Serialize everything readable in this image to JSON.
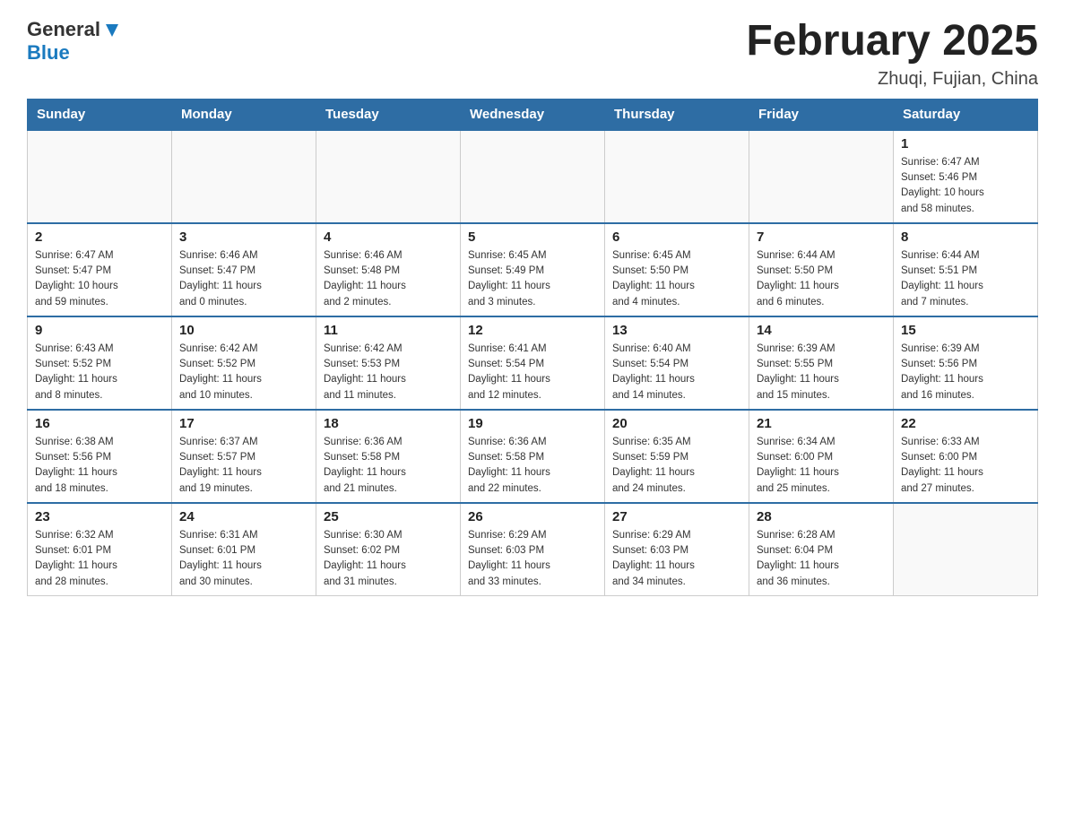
{
  "header": {
    "logo_general": "General",
    "logo_blue": "Blue",
    "month_title": "February 2025",
    "location": "Zhuqi, Fujian, China"
  },
  "weekdays": [
    "Sunday",
    "Monday",
    "Tuesday",
    "Wednesday",
    "Thursday",
    "Friday",
    "Saturday"
  ],
  "weeks": [
    [
      {
        "day": "",
        "info": ""
      },
      {
        "day": "",
        "info": ""
      },
      {
        "day": "",
        "info": ""
      },
      {
        "day": "",
        "info": ""
      },
      {
        "day": "",
        "info": ""
      },
      {
        "day": "",
        "info": ""
      },
      {
        "day": "1",
        "info": "Sunrise: 6:47 AM\nSunset: 5:46 PM\nDaylight: 10 hours\nand 58 minutes."
      }
    ],
    [
      {
        "day": "2",
        "info": "Sunrise: 6:47 AM\nSunset: 5:47 PM\nDaylight: 10 hours\nand 59 minutes."
      },
      {
        "day": "3",
        "info": "Sunrise: 6:46 AM\nSunset: 5:47 PM\nDaylight: 11 hours\nand 0 minutes."
      },
      {
        "day": "4",
        "info": "Sunrise: 6:46 AM\nSunset: 5:48 PM\nDaylight: 11 hours\nand 2 minutes."
      },
      {
        "day": "5",
        "info": "Sunrise: 6:45 AM\nSunset: 5:49 PM\nDaylight: 11 hours\nand 3 minutes."
      },
      {
        "day": "6",
        "info": "Sunrise: 6:45 AM\nSunset: 5:50 PM\nDaylight: 11 hours\nand 4 minutes."
      },
      {
        "day": "7",
        "info": "Sunrise: 6:44 AM\nSunset: 5:50 PM\nDaylight: 11 hours\nand 6 minutes."
      },
      {
        "day": "8",
        "info": "Sunrise: 6:44 AM\nSunset: 5:51 PM\nDaylight: 11 hours\nand 7 minutes."
      }
    ],
    [
      {
        "day": "9",
        "info": "Sunrise: 6:43 AM\nSunset: 5:52 PM\nDaylight: 11 hours\nand 8 minutes."
      },
      {
        "day": "10",
        "info": "Sunrise: 6:42 AM\nSunset: 5:52 PM\nDaylight: 11 hours\nand 10 minutes."
      },
      {
        "day": "11",
        "info": "Sunrise: 6:42 AM\nSunset: 5:53 PM\nDaylight: 11 hours\nand 11 minutes."
      },
      {
        "day": "12",
        "info": "Sunrise: 6:41 AM\nSunset: 5:54 PM\nDaylight: 11 hours\nand 12 minutes."
      },
      {
        "day": "13",
        "info": "Sunrise: 6:40 AM\nSunset: 5:54 PM\nDaylight: 11 hours\nand 14 minutes."
      },
      {
        "day": "14",
        "info": "Sunrise: 6:39 AM\nSunset: 5:55 PM\nDaylight: 11 hours\nand 15 minutes."
      },
      {
        "day": "15",
        "info": "Sunrise: 6:39 AM\nSunset: 5:56 PM\nDaylight: 11 hours\nand 16 minutes."
      }
    ],
    [
      {
        "day": "16",
        "info": "Sunrise: 6:38 AM\nSunset: 5:56 PM\nDaylight: 11 hours\nand 18 minutes."
      },
      {
        "day": "17",
        "info": "Sunrise: 6:37 AM\nSunset: 5:57 PM\nDaylight: 11 hours\nand 19 minutes."
      },
      {
        "day": "18",
        "info": "Sunrise: 6:36 AM\nSunset: 5:58 PM\nDaylight: 11 hours\nand 21 minutes."
      },
      {
        "day": "19",
        "info": "Sunrise: 6:36 AM\nSunset: 5:58 PM\nDaylight: 11 hours\nand 22 minutes."
      },
      {
        "day": "20",
        "info": "Sunrise: 6:35 AM\nSunset: 5:59 PM\nDaylight: 11 hours\nand 24 minutes."
      },
      {
        "day": "21",
        "info": "Sunrise: 6:34 AM\nSunset: 6:00 PM\nDaylight: 11 hours\nand 25 minutes."
      },
      {
        "day": "22",
        "info": "Sunrise: 6:33 AM\nSunset: 6:00 PM\nDaylight: 11 hours\nand 27 minutes."
      }
    ],
    [
      {
        "day": "23",
        "info": "Sunrise: 6:32 AM\nSunset: 6:01 PM\nDaylight: 11 hours\nand 28 minutes."
      },
      {
        "day": "24",
        "info": "Sunrise: 6:31 AM\nSunset: 6:01 PM\nDaylight: 11 hours\nand 30 minutes."
      },
      {
        "day": "25",
        "info": "Sunrise: 6:30 AM\nSunset: 6:02 PM\nDaylight: 11 hours\nand 31 minutes."
      },
      {
        "day": "26",
        "info": "Sunrise: 6:29 AM\nSunset: 6:03 PM\nDaylight: 11 hours\nand 33 minutes."
      },
      {
        "day": "27",
        "info": "Sunrise: 6:29 AM\nSunset: 6:03 PM\nDaylight: 11 hours\nand 34 minutes."
      },
      {
        "day": "28",
        "info": "Sunrise: 6:28 AM\nSunset: 6:04 PM\nDaylight: 11 hours\nand 36 minutes."
      },
      {
        "day": "",
        "info": ""
      }
    ]
  ]
}
